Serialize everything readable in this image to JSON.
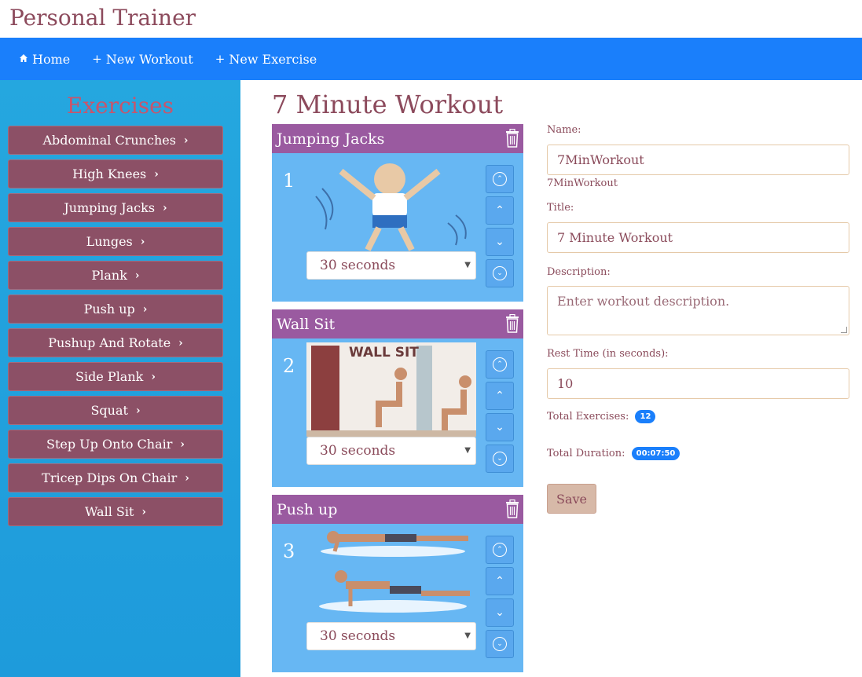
{
  "app": {
    "title": "Personal Trainer"
  },
  "nav": [
    {
      "label": "Home",
      "icon": "home-icon"
    },
    {
      "label": "New Workout",
      "icon": "plus-icon"
    },
    {
      "label": "New Exercise",
      "icon": "plus-icon"
    }
  ],
  "sidebar": {
    "title": "Exercises",
    "items": [
      "Abdominal Crunches",
      "High Knees",
      "Jumping Jacks",
      "Lunges",
      "Plank",
      "Push up",
      "Pushup And Rotate",
      "Side Plank",
      "Squat",
      "Step Up Onto Chair",
      "Tricep Dips On Chair",
      "Wall Sit"
    ]
  },
  "workout": {
    "title": "7 Minute Workout",
    "cards": [
      {
        "name": "Jumping Jacks",
        "number": "1",
        "duration": "30 seconds",
        "image_text": ""
      },
      {
        "name": "Wall Sit",
        "number": "2",
        "duration": "30 seconds",
        "image_text": "WALL SIT"
      },
      {
        "name": "Push up",
        "number": "3",
        "duration": "30 seconds",
        "image_text": ""
      }
    ]
  },
  "form": {
    "name_label": "Name:",
    "name_value": "7MinWorkout",
    "name_echo": "7MinWorkout",
    "title_label": "Title:",
    "title_value": "7 Minute Workout",
    "description_label": "Description:",
    "description_placeholder": "Enter workout description.",
    "rest_label": "Rest Time (in seconds):",
    "rest_value": "10",
    "total_exercises_label": "Total Exercises:",
    "total_exercises_value": "12",
    "total_duration_label": "Total Duration:",
    "total_duration_value": "00:07:50",
    "save_label": "Save"
  },
  "colors": {
    "navbar": "#1a7ffb",
    "sidebar": "#25a7df",
    "exercise_button": "#8c5066",
    "card": "#67b7f3",
    "card_header": "#9a5aa0",
    "badge": "#1a7ffb",
    "save_button": "#d7b9a8"
  }
}
